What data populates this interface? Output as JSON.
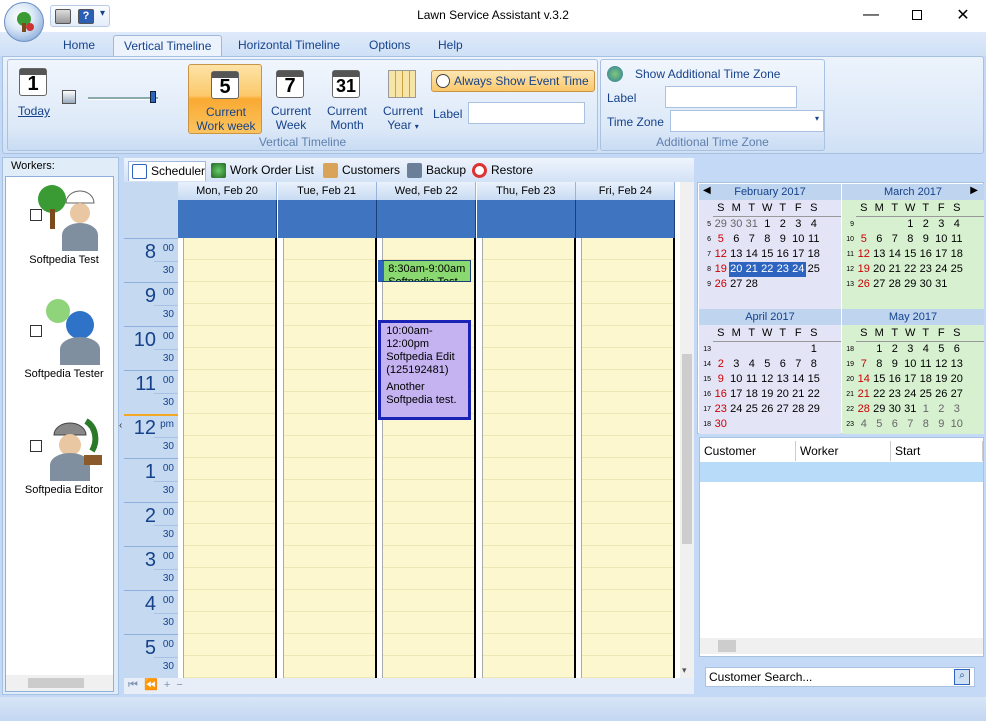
{
  "window": {
    "title": "Lawn Service Assistant v.3.2"
  },
  "tabs": [
    {
      "label": "Home"
    },
    {
      "label": "Vertical Timeline"
    },
    {
      "label": "Horizontal Timeline"
    },
    {
      "label": "Options"
    },
    {
      "label": "Help"
    }
  ],
  "ribbon": {
    "today": {
      "number": "1",
      "label": "Today"
    },
    "current_work_week": {
      "number": "5",
      "label_line1": "Current",
      "label_line2": "Work week"
    },
    "current_week": {
      "number": "7",
      "label_line1": "Current",
      "label_line2": "Week"
    },
    "current_month": {
      "number": "31",
      "label_line1": "Current",
      "label_line2": "Month"
    },
    "current_year": {
      "label_line1": "Current",
      "label_line2": "Year"
    },
    "always_show_event_time": "Always Show Event Time",
    "label_caption": "Label",
    "group_vertical_timeline": "Vertical Timeline",
    "show_additional_tz": "Show Additional Time Zone",
    "tz_label_caption": "Label",
    "tz_caption": "Time Zone",
    "group_additional_tz": "Additional Time Zone"
  },
  "workers": {
    "header": "Workers:",
    "items": [
      {
        "name": "Softpedia Test"
      },
      {
        "name": "Softpedia Tester"
      },
      {
        "name": "Softpedia Editor"
      }
    ]
  },
  "toolbar": {
    "scheduler": "Scheduler",
    "work_order_list": "Work Order List",
    "customers": "Customers",
    "backup": "Backup",
    "restore": "Restore"
  },
  "scheduler": {
    "days": [
      "Mon, Feb 20",
      "Tue, Feb 21",
      "Wed, Feb 22",
      "Thu, Feb 23",
      "Fri, Feb 24"
    ],
    "hours": [
      {
        "h": "8",
        "m": "00",
        "m30": "30"
      },
      {
        "h": "9",
        "m": "00",
        "m30": "30"
      },
      {
        "h": "10",
        "m": "00",
        "m30": "30"
      },
      {
        "h": "11",
        "m": "00",
        "m30": "30"
      },
      {
        "h": "12",
        "m": "pm",
        "m30": "30"
      },
      {
        "h": "1",
        "m": "00",
        "m30": "30"
      },
      {
        "h": "2",
        "m": "00",
        "m30": "30"
      },
      {
        "h": "3",
        "m": "00",
        "m30": "30"
      },
      {
        "h": "4",
        "m": "00",
        "m30": "30"
      },
      {
        "h": "5",
        "m": "00",
        "m30": "30"
      }
    ],
    "appointments": [
      {
        "day": 2,
        "time": "8:30am-9:00am",
        "line2": "Softpedia Test",
        "color": "#8ad870"
      },
      {
        "day": 2,
        "time": "10:00am-12:00pm",
        "line2": "Softpedia Edit",
        "line3": "(125192481)",
        "line4": "Another",
        "line5": "Softpedia test.",
        "color": "#c4b3f0"
      }
    ]
  },
  "mini_calendars": [
    {
      "title": "February 2017",
      "headers": [
        "S",
        "M",
        "T",
        "W",
        "T",
        "F",
        "S"
      ],
      "weeks": [
        {
          "wk": "5",
          "days": [
            "29",
            "30",
            "31",
            "1",
            "2",
            "3",
            "4"
          ]
        },
        {
          "wk": "6",
          "days": [
            "5",
            "6",
            "7",
            "8",
            "9",
            "10",
            "11"
          ]
        },
        {
          "wk": "7",
          "days": [
            "12",
            "13",
            "14",
            "15",
            "16",
            "17",
            "18"
          ]
        },
        {
          "wk": "8",
          "days": [
            "19",
            "20",
            "21",
            "22",
            "23",
            "24",
            "25"
          ]
        },
        {
          "wk": "9",
          "days": [
            "26",
            "27",
            "28",
            "",
            "",
            "",
            ""
          ]
        }
      ]
    },
    {
      "title": "March 2017",
      "headers": [
        "S",
        "M",
        "T",
        "W",
        "T",
        "F",
        "S"
      ],
      "weeks": [
        {
          "wk": "9",
          "days": [
            "",
            "",
            "",
            "1",
            "2",
            "3",
            "4"
          ]
        },
        {
          "wk": "10",
          "days": [
            "5",
            "6",
            "7",
            "8",
            "9",
            "10",
            "11"
          ]
        },
        {
          "wk": "11",
          "days": [
            "12",
            "13",
            "14",
            "15",
            "16",
            "17",
            "18"
          ]
        },
        {
          "wk": "12",
          "days": [
            "19",
            "20",
            "21",
            "22",
            "23",
            "24",
            "25"
          ]
        },
        {
          "wk": "13",
          "days": [
            "26",
            "27",
            "28",
            "29",
            "30",
            "31",
            ""
          ]
        }
      ]
    },
    {
      "title": "April 2017",
      "headers": [
        "S",
        "M",
        "T",
        "W",
        "T",
        "F",
        "S"
      ],
      "weeks": [
        {
          "wk": "13",
          "days": [
            "",
            "",
            "",
            "",
            "",
            "",
            "1"
          ]
        },
        {
          "wk": "14",
          "days": [
            "2",
            "3",
            "4",
            "5",
            "6",
            "7",
            "8"
          ]
        },
        {
          "wk": "15",
          "days": [
            "9",
            "10",
            "11",
            "12",
            "13",
            "14",
            "15"
          ]
        },
        {
          "wk": "16",
          "days": [
            "16",
            "17",
            "18",
            "19",
            "20",
            "21",
            "22"
          ]
        },
        {
          "wk": "17",
          "days": [
            "23",
            "24",
            "25",
            "26",
            "27",
            "28",
            "29"
          ]
        },
        {
          "wk": "18",
          "days": [
            "30",
            "",
            "",
            "",
            "",
            "",
            ""
          ]
        }
      ]
    },
    {
      "title": "May 2017",
      "headers": [
        "S",
        "M",
        "T",
        "W",
        "T",
        "F",
        "S"
      ],
      "weeks": [
        {
          "wk": "18",
          "days": [
            "",
            "1",
            "2",
            "3",
            "4",
            "5",
            "6"
          ]
        },
        {
          "wk": "19",
          "days": [
            "7",
            "8",
            "9",
            "10",
            "11",
            "12",
            "13"
          ]
        },
        {
          "wk": "20",
          "days": [
            "14",
            "15",
            "16",
            "17",
            "18",
            "19",
            "20"
          ]
        },
        {
          "wk": "21",
          "days": [
            "21",
            "22",
            "23",
            "24",
            "25",
            "26",
            "27"
          ]
        },
        {
          "wk": "22",
          "days": [
            "28",
            "29",
            "30",
            "31",
            "1",
            "2",
            "3"
          ]
        },
        {
          "wk": "23",
          "days": [
            "4",
            "5",
            "6",
            "7",
            "8",
            "9",
            "10"
          ]
        }
      ]
    }
  ],
  "customer_grid": {
    "columns": [
      "Customer",
      "Worker",
      "Start"
    ],
    "search_placeholder": "Customer Search..."
  },
  "colors": {
    "accent": "#15428b",
    "selected_day": "#2d64c0",
    "ribbon_selected": "#f9a932"
  }
}
